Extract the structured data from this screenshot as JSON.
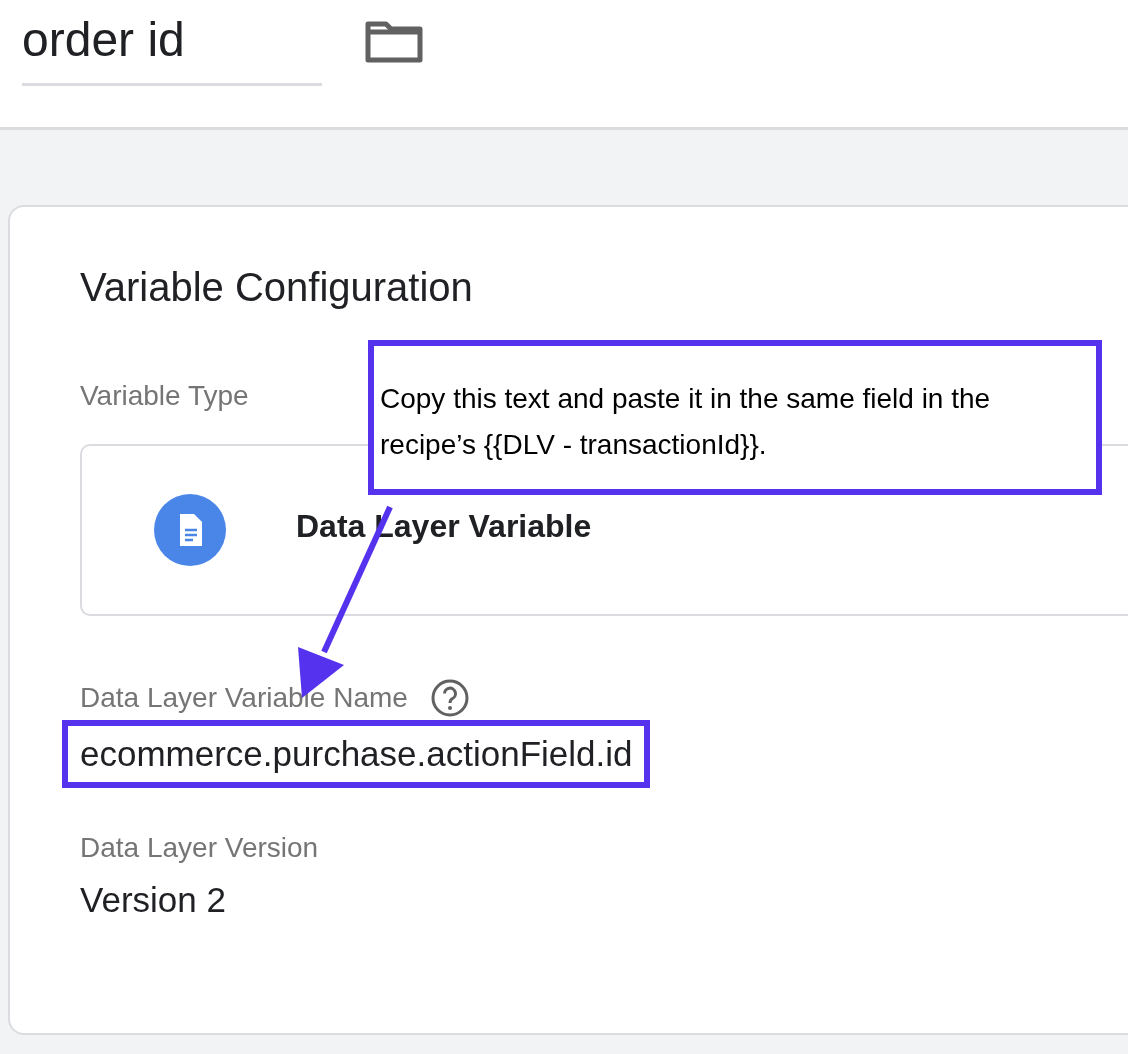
{
  "name_field": {
    "value": "order id"
  },
  "card": {
    "title": "Variable Configuration",
    "variable_type": {
      "label": "Variable Type",
      "value": "Data Layer Variable"
    },
    "fields": [
      {
        "label": "Data Layer Variable Name",
        "value": "ecommerce.purchase.actionField.id",
        "help": true,
        "highlighted": true
      },
      {
        "label": "Data Layer Version",
        "value": "Version 2",
        "help": false,
        "highlighted": false
      }
    ]
  },
  "annotation": {
    "text": "Copy this text and paste it in the same field in the recipe’s {{DLV - transactionId}}."
  }
}
